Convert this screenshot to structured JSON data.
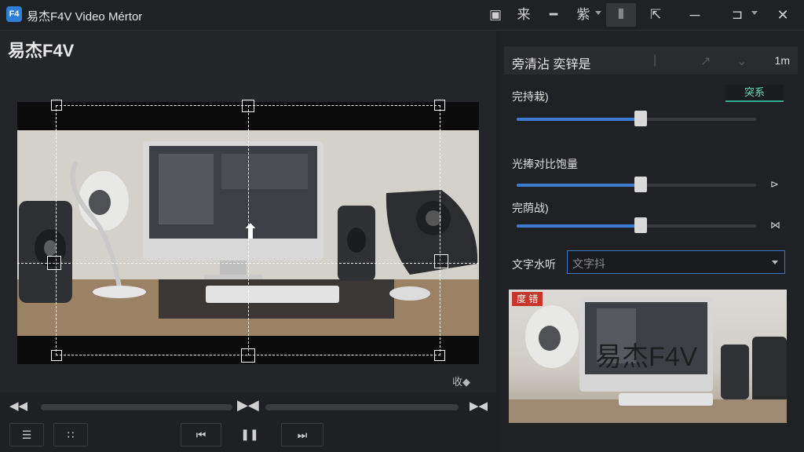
{
  "window": {
    "app_icon": "F4",
    "title": "易杰F4V Video Mértor"
  },
  "toolbar": {
    "buttons": [
      {
        "name": "crop-tool-icon",
        "glyph": "▣"
      },
      {
        "name": "text-tool-icon",
        "glyph": "来"
      },
      {
        "name": "line-tool-icon",
        "glyph": "━"
      },
      {
        "name": "filter-tool-icon",
        "glyph": "紫"
      },
      {
        "name": "split-tool-icon",
        "glyph": "⫴"
      },
      {
        "name": "export-tool-icon",
        "glyph": "⇱"
      },
      {
        "name": "share-tool-icon",
        "glyph": "⊐"
      }
    ]
  },
  "page": {
    "title": "易杰F4V"
  },
  "player": {
    "collapse_label": "收◆"
  },
  "settings": {
    "header_title": "旁清沾 奕锌是",
    "header_value": "1m",
    "action_button": "突系",
    "sliders": [
      {
        "label": "完持栽)",
        "value": 0.52
      },
      {
        "label": "光捧对比饱量",
        "value": 0.52,
        "end_icon": "⊳"
      },
      {
        "label": "完荫战)",
        "value": 0.52,
        "end_icon": "⋈"
      }
    ],
    "watermark_label": "文字水听",
    "watermark_placeholder": "文字抖"
  },
  "preview": {
    "badge": "度 错",
    "overlay_text": "易杰F4V"
  }
}
